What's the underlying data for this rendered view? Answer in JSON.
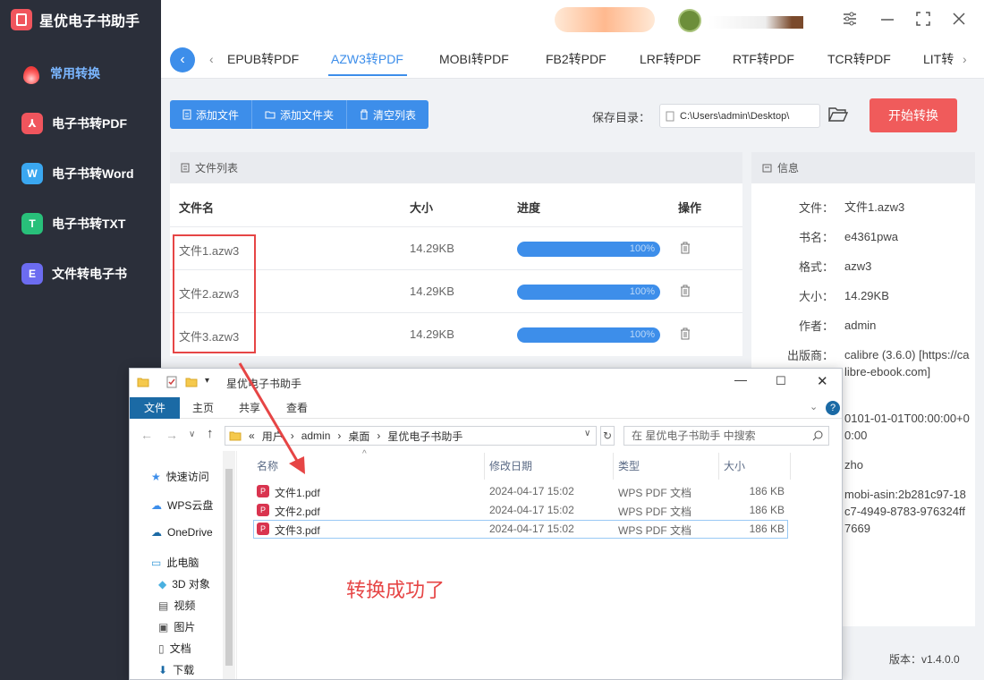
{
  "app": {
    "name": "星优电子书助手"
  },
  "sidebar": {
    "items": [
      {
        "label": "常用转换",
        "icon": "flame-icon",
        "color": "#f03c3c",
        "active": true
      },
      {
        "label": "电子书转PDF",
        "icon": "pdf-icon",
        "glyph": "⅄",
        "color": "#f0555d"
      },
      {
        "label": "电子书转Word",
        "icon": "word-icon",
        "glyph": "W",
        "color": "#3aa7f0"
      },
      {
        "label": "电子书转TXT",
        "icon": "txt-icon",
        "glyph": "T",
        "color": "#28c07a"
      },
      {
        "label": "文件转电子书",
        "icon": "ebook-icon",
        "glyph": "E",
        "color": "#6c6cf0"
      }
    ]
  },
  "tabs": [
    "EPUB转PDF",
    "AZW3转PDF",
    "MOBI转PDF",
    "FB2转PDF",
    "LRF转PDF",
    "RTF转PDF",
    "TCR转PDF",
    "LIT转"
  ],
  "active_tab": "AZW3转PDF",
  "toolbar": {
    "add_file": "添加文件",
    "add_folder": "添加文件夹",
    "clear_list": "清空列表"
  },
  "save": {
    "label": "保存目录：",
    "path": "C:\\Users\\admin\\Desktop\\"
  },
  "start_button": "开始转换",
  "file_list": {
    "title": "文件列表",
    "columns": [
      "文件名",
      "大小",
      "进度",
      "操作"
    ],
    "rows": [
      {
        "name": "文件1.azw3",
        "size": "14.29KB",
        "progress": "100%"
      },
      {
        "name": "文件2.azw3",
        "size": "14.29KB",
        "progress": "100%"
      },
      {
        "name": "文件3.azw3",
        "size": "14.29KB",
        "progress": "100%"
      }
    ]
  },
  "info": {
    "title": "信息",
    "fields": [
      {
        "k": "文件：",
        "v": "文件1.azw3"
      },
      {
        "k": "书名：",
        "v": "e4361pwa"
      },
      {
        "k": "格式：",
        "v": "azw3"
      },
      {
        "k": "大小：",
        "v": "14.29KB"
      },
      {
        "k": "作者：",
        "v": "admin"
      },
      {
        "k": "出版商：",
        "v": "calibre (3.6.0) [https://calibre-ebook.com]"
      },
      {
        "k": "",
        "v": "0101-01-01T00:00:00+00:00"
      },
      {
        "k": "",
        "v": "zho"
      },
      {
        "k": "",
        "v": "mobi-asin:2b281c97-18c7-4949-8783-976324ff7669"
      }
    ]
  },
  "version": "版本：v1.4.0.0",
  "explorer": {
    "title": "星优电子书助手",
    "ribbon": [
      "文件",
      "主页",
      "共享",
      "查看"
    ],
    "breadcrumb": [
      "«",
      "用户",
      "admin",
      "桌面",
      "星优电子书助手"
    ],
    "search_placeholder": "在 星优电子书助手 中搜索",
    "nav": [
      "快速访问",
      "WPS云盘",
      "OneDrive",
      "此电脑",
      "3D 对象",
      "视频",
      "图片",
      "文档",
      "下载"
    ],
    "columns": [
      "名称",
      "修改日期",
      "类型",
      "大小"
    ],
    "files": [
      {
        "name": "文件1.pdf",
        "date": "2024-04-17 15:02",
        "type": "WPS PDF 文档",
        "size": "186 KB"
      },
      {
        "name": "文件2.pdf",
        "date": "2024-04-17 15:02",
        "type": "WPS PDF 文档",
        "size": "186 KB"
      },
      {
        "name": "文件3.pdf",
        "date": "2024-04-17 15:02",
        "type": "WPS PDF 文档",
        "size": "186 KB"
      }
    ]
  },
  "annotation": "转换成功了"
}
